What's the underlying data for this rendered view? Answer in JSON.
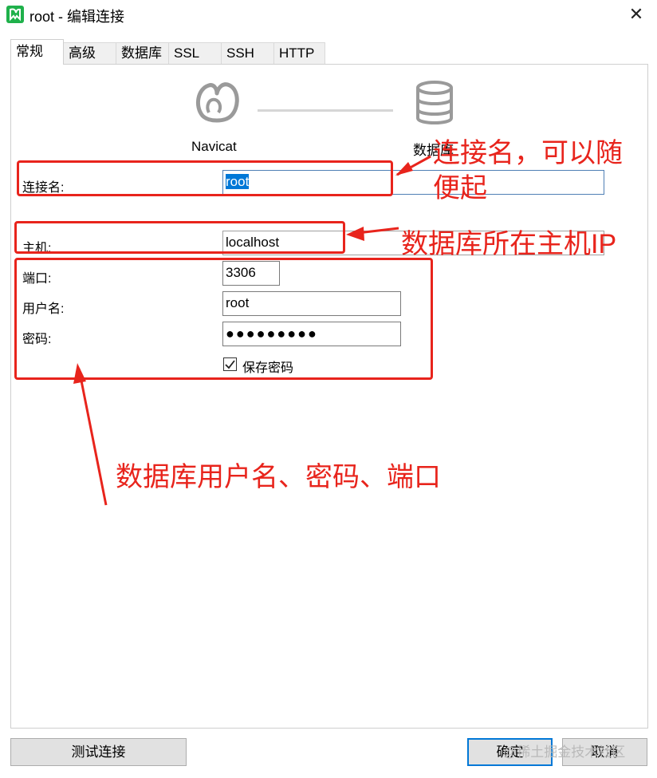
{
  "window": {
    "title": "root - 编辑连接",
    "close_glyph": "✕"
  },
  "tabs": [
    {
      "label": "常规",
      "active": true
    },
    {
      "label": "高级",
      "active": false
    },
    {
      "label": "数据库",
      "active": false
    },
    {
      "label": "SSL",
      "active": false
    },
    {
      "label": "SSH",
      "active": false
    },
    {
      "label": "HTTP",
      "active": false
    }
  ],
  "header": {
    "left_label": "Navicat",
    "right_label": "数据库",
    "left_icon": "navicat-logo-icon",
    "right_icon": "database-icon"
  },
  "form": {
    "connection_name": {
      "label": "连接名:",
      "value": "root"
    },
    "host": {
      "label": "主机:",
      "value": "localhost"
    },
    "port": {
      "label": "端口:",
      "value": "3306"
    },
    "username": {
      "label": "用户名:",
      "value": "root"
    },
    "password": {
      "label": "密码:",
      "value": "●●●●●●●●●"
    },
    "save_password": {
      "label": "保存密码",
      "checked": true
    }
  },
  "annotations": {
    "connection_name_note_line1": "连接名，可以随",
    "connection_name_note_line2": "便起",
    "host_note": "数据库所在主机IP",
    "credentials_note": "数据库用户名、密码、端口",
    "color": "#e8241c"
  },
  "buttons": {
    "test": "测试连接",
    "ok": "确定",
    "cancel": "取消"
  },
  "watermark": "@稀土掘金技术社区",
  "colors": {
    "selection": "#0078d7",
    "annotation": "#e8241c",
    "app_icon": "#1fb14b"
  }
}
